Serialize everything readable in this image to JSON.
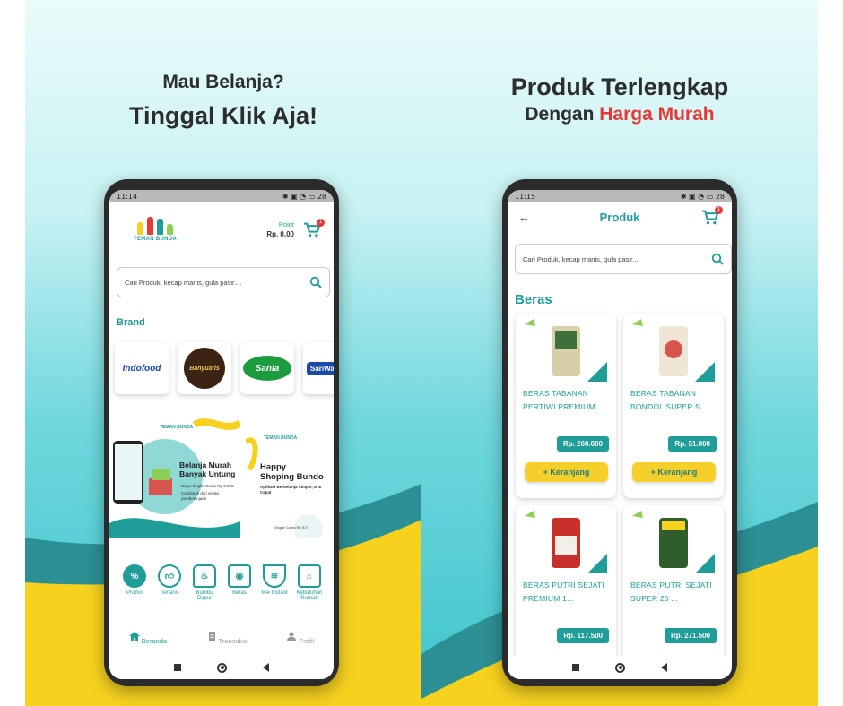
{
  "colors": {
    "teal": "#1f9d99",
    "yellow": "#f7cf2a",
    "red": "#e53935",
    "dark": "#2d2d2d"
  },
  "left_panel": {
    "headline_line1": "Mau Belanja?",
    "headline_line2": "Tinggal Klik Aja!"
  },
  "right_panel": {
    "headline_line1": "Produk Terlengkap",
    "headline_line2_a": "Dengan",
    "headline_line2_b": "Harga Murah"
  },
  "home_screen": {
    "status_time": "11:14",
    "status_battery": "28",
    "logo_text": "TEMAN BUNDA",
    "point_label": "Point",
    "point_value": "Rp. 0,00",
    "cart_count": "1",
    "search_placeholder": "Cari Produk, kecap manis, gula pasir....",
    "brand_label": "Brand",
    "brands": [
      "Indofood",
      "Banyuatis",
      "Sania",
      "SariWan"
    ],
    "banner1": {
      "logo": "TEMAN BUNDA",
      "title": "Belanja Murah Banyak Untung",
      "line1": "Biaya Ongkir Cuma Rp 3.000",
      "line2": "Cashback dari setiap pembelanjaan"
    },
    "banner2": {
      "logo": "TEMAN BUNDA",
      "title1": "Happy",
      "title2": "Shoping Bundo",
      "subtitle": "Aplikasi Berbelanja Simple, M & Cepat",
      "foot": "Ongkir Cuma Rp 3.0"
    },
    "categories": [
      {
        "label": "Promo",
        "icon": "promo-icon"
      },
      {
        "label": "Terlaris",
        "icon": "thumbs-up-icon"
      },
      {
        "label": "Bumbu Dapur",
        "icon": "chef-hat-icon"
      },
      {
        "label": "Beras",
        "icon": "rice-sack-icon"
      },
      {
        "label": "Mie Instant",
        "icon": "noodle-bowl-icon"
      },
      {
        "label": "Kebutuhan Rumah",
        "icon": "cleaning-icon"
      }
    ],
    "tabs": [
      {
        "label": "Beranda",
        "icon": "home-icon"
      },
      {
        "label": "Transaksi",
        "icon": "document-icon"
      },
      {
        "label": "Profil",
        "icon": "user-icon"
      }
    ]
  },
  "product_screen": {
    "status_time": "11:15",
    "status_battery": "28",
    "title": "Produk",
    "cart_count": "1",
    "search_placeholder": "Cari Produk, kecap manis, gula pasir....",
    "section": "Beras",
    "add_label": "+ Keranjang",
    "products": [
      {
        "name": "BERAS TABANAN PERTIWI PREMIUM ...",
        "price": "Rp. 260.000"
      },
      {
        "name": "BERAS TABANAN BONDOL SUPER 5 ...",
        "price": "Rp. 51.000"
      },
      {
        "name": "BERAS PUTRI SEJATI PREMIUM 1...",
        "price": "Rp. 117.500"
      },
      {
        "name": "BERAS PUTRI SEJATI SUPER 25 ...",
        "price": "Rp. 271.500"
      }
    ]
  }
}
